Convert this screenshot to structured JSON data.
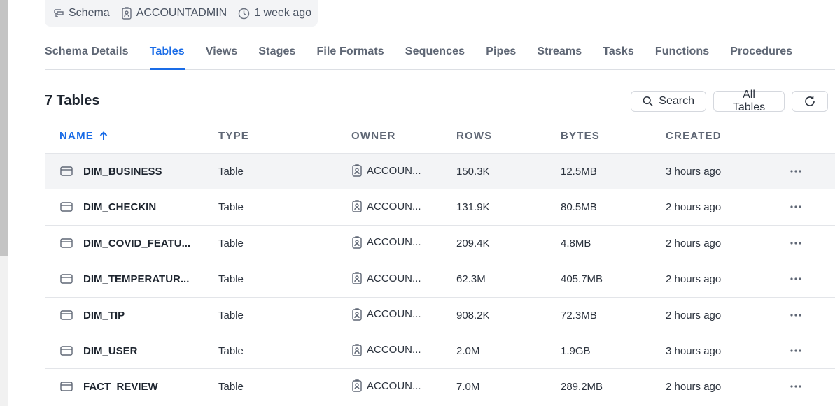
{
  "meta": {
    "type_label": "Schema",
    "owner_label": "ACCOUNTADMIN",
    "time_label": "1 week ago"
  },
  "tabs": [
    {
      "label": "Schema Details"
    },
    {
      "label": "Tables",
      "active": true
    },
    {
      "label": "Views"
    },
    {
      "label": "Stages"
    },
    {
      "label": "File Formats"
    },
    {
      "label": "Sequences"
    },
    {
      "label": "Pipes"
    },
    {
      "label": "Streams"
    },
    {
      "label": "Tasks"
    },
    {
      "label": "Functions"
    },
    {
      "label": "Procedures"
    }
  ],
  "list": {
    "count_title": "7 Tables",
    "search_label": "Search",
    "filter_label": "All Tables"
  },
  "columns": {
    "name": "NAME",
    "type": "TYPE",
    "owner": "OWNER",
    "rows": "ROWS",
    "bytes": "BYTES",
    "created": "CREATED"
  },
  "rows": [
    {
      "name": "DIM_BUSINESS",
      "type": "Table",
      "owner": "ACCOUN...",
      "rows": "150.3K",
      "bytes": "12.5MB",
      "created": "3 hours ago"
    },
    {
      "name": "DIM_CHECKIN",
      "type": "Table",
      "owner": "ACCOUN...",
      "rows": "131.9K",
      "bytes": "80.5MB",
      "created": "2 hours ago"
    },
    {
      "name": "DIM_COVID_FEATU...",
      "type": "Table",
      "owner": "ACCOUN...",
      "rows": "209.4K",
      "bytes": "4.8MB",
      "created": "2 hours ago"
    },
    {
      "name": "DIM_TEMPERATUR...",
      "type": "Table",
      "owner": "ACCOUN...",
      "rows": "62.3M",
      "bytes": "405.7MB",
      "created": "2 hours ago"
    },
    {
      "name": "DIM_TIP",
      "type": "Table",
      "owner": "ACCOUN...",
      "rows": "908.2K",
      "bytes": "72.3MB",
      "created": "2 hours ago"
    },
    {
      "name": "DIM_USER",
      "type": "Table",
      "owner": "ACCOUN...",
      "rows": "2.0M",
      "bytes": "1.9GB",
      "created": "3 hours ago"
    },
    {
      "name": "FACT_REVIEW",
      "type": "Table",
      "owner": "ACCOUN...",
      "rows": "7.0M",
      "bytes": "289.2MB",
      "created": "2 hours ago"
    }
  ],
  "colors": {
    "accent": "#1a6ce7",
    "hover_row": "#f3f4f6"
  }
}
